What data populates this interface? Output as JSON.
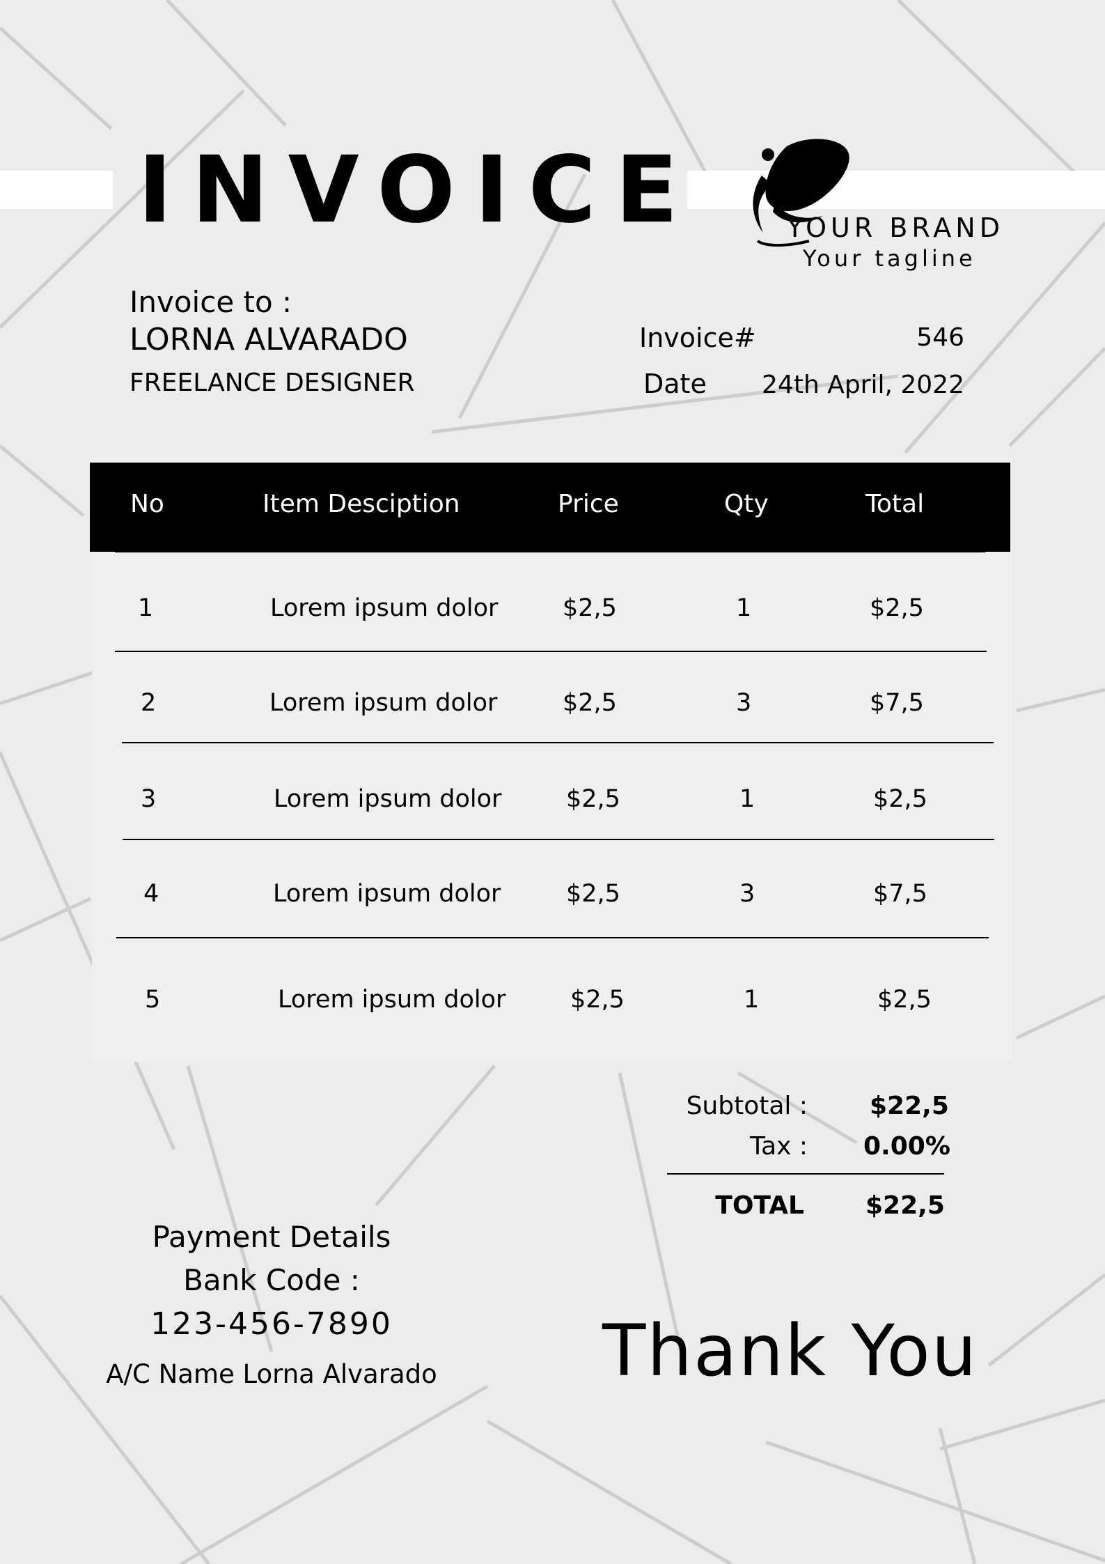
{
  "header": {
    "title": "INVOICE",
    "brand_name": "YOUR BRAND",
    "brand_tagline": "Your tagline",
    "logo_icon": "leaf-swirl-icon"
  },
  "bill_to": {
    "label": "Invoice to :",
    "name": "LORNA ALVARADO",
    "role": "FREELANCE DESIGNER"
  },
  "meta": {
    "invoice_label": "Invoice#",
    "invoice_number": "546",
    "date_label": "Date",
    "date_value": "24th April, 2022"
  },
  "table": {
    "headers": {
      "no": "No",
      "description": "Item Desciption",
      "price": "Price",
      "qty": "Qty",
      "total": "Total"
    },
    "rows": [
      {
        "no": "1",
        "description": "Lorem ipsum dolor",
        "price": "$2,5",
        "qty": "1",
        "total": "$2,5"
      },
      {
        "no": "2",
        "description": "Lorem ipsum dolor",
        "price": "$2,5",
        "qty": "3",
        "total": "$7,5"
      },
      {
        "no": "3",
        "description": "Lorem ipsum dolor",
        "price": "$2,5",
        "qty": "1",
        "total": "$2,5"
      },
      {
        "no": "4",
        "description": "Lorem ipsum dolor",
        "price": "$2,5",
        "qty": "3",
        "total": "$7,5"
      },
      {
        "no": "5",
        "description": "Lorem ipsum dolor",
        "price": "$2,5",
        "qty": "1",
        "total": "$2,5"
      }
    ]
  },
  "summary": {
    "subtotal_label": "Subtotal :",
    "subtotal_value": "$22,5",
    "tax_label": "Tax :",
    "tax_value": "0.00%",
    "total_label": "TOTAL",
    "total_value": "$22,5"
  },
  "payment": {
    "title": "Payment Details",
    "bank_label": "Bank Code :",
    "bank_code": "123-456-7890",
    "account_name": "A/C Name Lorna Alvarado"
  },
  "footer": {
    "thanks": "Thank You"
  },
  "colors": {
    "background": "#ececec",
    "table_body": "#efefef",
    "table_header": "#000000",
    "text": "#000000",
    "band": "#ffffff"
  }
}
